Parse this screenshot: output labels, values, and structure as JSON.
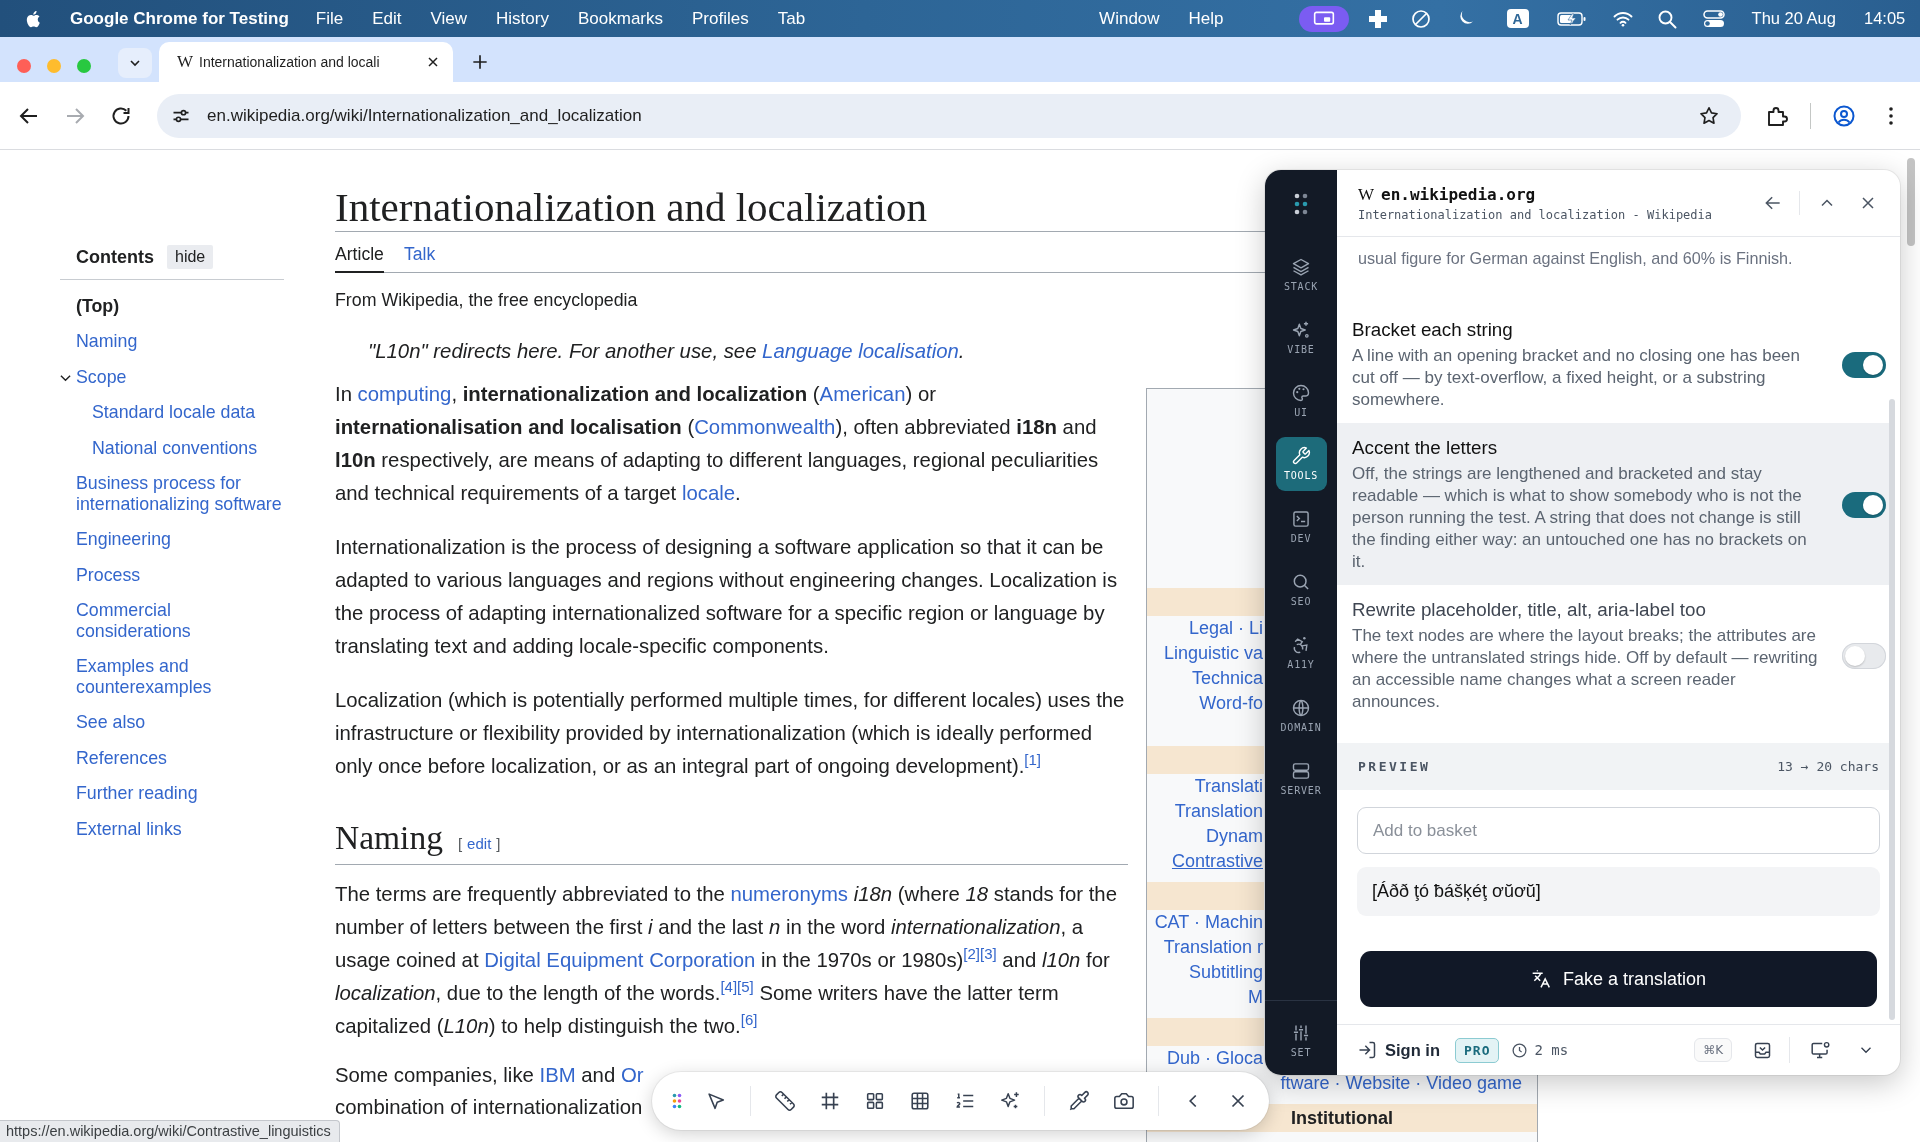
{
  "menu_bar": {
    "app_name": "Google Chrome for Testing",
    "menus": [
      "File",
      "Edit",
      "View",
      "History",
      "Bookmarks",
      "Profiles",
      "Tab"
    ],
    "menus_right": [
      "Window",
      "Help"
    ],
    "input_source": "A",
    "date": "Thu 20 Aug",
    "time": "14:05"
  },
  "browser": {
    "tabs": [
      {
        "favicon": "W",
        "title": "Internationalization and locali",
        "selected": true
      }
    ],
    "back_disabled": false,
    "forward_disabled": true,
    "url": "en.wikipedia.org/wiki/Internationalization_and_localization",
    "status_url": "https://en.wikipedia.org/wiki/Contrastive_linguistics"
  },
  "toc": {
    "title": "Contents",
    "hide_label": "hide",
    "items": [
      {
        "label": "(Top)",
        "selected": true
      },
      {
        "label": "Naming",
        "selected": false
      },
      {
        "label": "Scope",
        "selected": false,
        "expanded": true,
        "children": [
          {
            "label": "Standard locale data",
            "selected": false
          },
          {
            "label": "National conventions",
            "selected": false
          }
        ]
      },
      {
        "label": "Business process for internationalizing software",
        "selected": false
      },
      {
        "label": "Engineering",
        "selected": false
      },
      {
        "label": "Process",
        "selected": false
      },
      {
        "label": "Commercial considerations",
        "selected": false
      },
      {
        "label": "Examples and counterexamples",
        "selected": false
      },
      {
        "label": "See also",
        "selected": false
      },
      {
        "label": "References",
        "selected": false
      },
      {
        "label": "Further reading",
        "selected": false
      },
      {
        "label": "External links",
        "selected": false
      }
    ]
  },
  "article": {
    "title": "Internationalization and localization",
    "tabs": [
      {
        "label": "Article",
        "selected": true
      },
      {
        "label": "Talk",
        "selected": false
      }
    ],
    "tagline": "From Wikipedia, the free encyclopedia",
    "hatnote": [
      {
        "kind": "text",
        "text": "\"L10n\" redirects here. For another use, see "
      },
      {
        "kind": "link",
        "text": "Language localisation"
      },
      {
        "kind": "text",
        "text": "."
      }
    ],
    "blocks": [
      {
        "kind": "paragraph",
        "runs": [
          {
            "kind": "text",
            "text": "In "
          },
          {
            "kind": "link",
            "text": "computing"
          },
          {
            "kind": "text",
            "text": ", **internationalization and localization** ("
          },
          {
            "kind": "link",
            "text": "American"
          },
          {
            "kind": "text",
            "text": ") or **internationalisation and localisation** ("
          },
          {
            "kind": "link",
            "text": "Commonwealth"
          },
          {
            "kind": "text",
            "text": "), often abbreviated **i18n** and **l10n** respectively, are means of adapting to different languages, regional peculiarities and technical requirements of a target "
          },
          {
            "kind": "link",
            "text": "locale"
          },
          {
            "kind": "text",
            "text": "."
          }
        ]
      },
      {
        "kind": "paragraph",
        "runs": [
          {
            "kind": "text",
            "text": "Internationalization is the process of designing a software application so that it can be adapted to various languages and regions without engineering changes. Localization is the process of adapting internationalized software for a specific region or language by translating text and adding locale-specific components."
          }
        ]
      },
      {
        "kind": "paragraph",
        "runs": [
          {
            "kind": "text",
            "text": "Localization (which is potentially performed multiple times, for different locales) uses the infrastructure or flexibility provided by internationalization (which is ideally performed only once before localization, or as an integral part of ongoing development)."
          },
          {
            "kind": "ref",
            "text": "[1]"
          }
        ]
      },
      {
        "kind": "heading",
        "text": "Naming",
        "edit": [
          {
            "kind": "text",
            "text": "["
          },
          {
            "kind": "link",
            "text": "edit"
          },
          {
            "kind": "text",
            "text": "]"
          }
        ]
      },
      {
        "kind": "paragraph",
        "runs": [
          {
            "kind": "text",
            "text": "The terms are frequently abbreviated to the "
          },
          {
            "kind": "link",
            "text": "numeronyms"
          },
          {
            "kind": "text",
            "text": " *i18n* (where *18* stands for the number of letters between the first *i* and the last *n* in the word *internationalization*, a usage coined at "
          },
          {
            "kind": "link",
            "text": "Digital Equipment Corporation"
          },
          {
            "kind": "text",
            "text": " in the 1970s or 1980s)"
          },
          {
            "kind": "ref",
            "text": "[2]"
          },
          {
            "kind": "ref",
            "text": "[3]"
          },
          {
            "kind": "text",
            "text": " and *l10n* for *localization*, due to the length of the words."
          },
          {
            "kind": "ref",
            "text": "[4]"
          },
          {
            "kind": "ref",
            "text": "[5]"
          },
          {
            "kind": "text",
            "text": " Some writers have the latter term capitalized (*L10n*) to help distinguish the two."
          },
          {
            "kind": "ref",
            "text": "[6]"
          }
        ]
      },
      {
        "kind": "cut_paragraph",
        "lines": [
          [
            {
              "kind": "text",
              "text": "Some companies, like "
            },
            {
              "kind": "link",
              "text": "IBM"
            },
            {
              "kind": "text",
              "text": " and "
            },
            {
              "kind": "link",
              "text": "Or"
            }
          ],
          [
            {
              "kind": "text",
              "text": "combination of internationalization"
            }
          ]
        ]
      }
    ]
  },
  "infobox": {
    "sections": [
      {
        "lines": [
          {
            "kind": "left_part",
            "text": "Legal · Li",
            "hovered": false
          },
          {
            "kind": "left_part",
            "text": "Linguistic va",
            "hovered": false
          },
          {
            "kind": "left_part",
            "text": "Technica",
            "hovered": false
          },
          {
            "kind": "left_part",
            "text": "Word-fo",
            "hovered": false
          }
        ]
      },
      {
        "lines": [
          {
            "kind": "left_part",
            "text": "Translati",
            "hovered": false
          },
          {
            "kind": "left_part",
            "text": "Translation",
            "hovered": false
          },
          {
            "kind": "left_part",
            "text": "Dynam",
            "hovered": false
          },
          {
            "kind": "left_part",
            "text": "Contrastive",
            "hovered": true
          }
        ]
      },
      {
        "lines": [
          {
            "kind": "left_part",
            "text": "CAT · Machin",
            "hovered": false
          },
          {
            "kind": "left_part",
            "text": "Translation r",
            "hovered": false
          },
          {
            "kind": "left_part",
            "text": "Subtitling",
            "hovered": false
          },
          {
            "kind": "left_part",
            "text": "M",
            "hovered": false
          }
        ]
      },
      {
        "lines": [
          {
            "kind": "left_part",
            "text": "Dub · Gloca",
            "hovered": false
          },
          {
            "kind": "right_part",
            "text": "ftware · Website · Video game",
            "hovered": false
          }
        ]
      },
      {
        "header": "Institutional"
      }
    ]
  },
  "devtool_panel": {
    "rail": {
      "items": [
        {
          "label": "STACK",
          "selected": false
        },
        {
          "label": "VIBE",
          "selected": false
        },
        {
          "label": "UI",
          "selected": false
        },
        {
          "label": "TOOLS",
          "selected": true
        },
        {
          "label": "DEV",
          "selected": false
        },
        {
          "label": "SEO",
          "selected": false
        },
        {
          "label": "A11Y",
          "selected": false
        },
        {
          "label": "DOMAIN",
          "selected": false
        },
        {
          "label": "SERVER",
          "selected": false
        }
      ],
      "bottom_item": {
        "label": "SET"
      }
    },
    "header": {
      "favicon": "W",
      "site": "en.wikipedia.org",
      "page_title": "Internationalization and localization - Wikipedia"
    },
    "intro_tail": "usual figure for German against English, and 60% is Finnish.",
    "options": [
      {
        "title": "Bracket each string",
        "description": "A line with an opening bracket and no closing one has been cut off — by text-overflow, a fixed height, or a substring somewhere.",
        "on": true,
        "highlighted": false
      },
      {
        "title": "Accent the letters",
        "description": "Off, the strings are lengthened and bracketed and stay readable — which is what to show somebody who is not the person running the test. A string that does not change is still the finding either way: an untouched one has no brackets on it.",
        "on": true,
        "highlighted": true
      },
      {
        "title": "Rewrite placeholder, title, alt, aria-label too",
        "description": "The text nodes are where the layout breaks; the attributes are where the untranslated strings hide. Off by default — rewriting an accessible name changes what a screen reader announces.",
        "on": false,
        "highlighted": false
      }
    ],
    "preview": {
      "label": "PREVIEW",
      "stats": "13 → 20 chars",
      "input": {
        "placeholder": "Add to basket"
      },
      "output": "[Áðð ţó ƀášķéţ ơŭơŭ]"
    },
    "action_button": "Fake a translation",
    "footer": {
      "sign_in": "Sign in",
      "plan_badge": "PRO",
      "timing": "2 ms",
      "shortcut": "⌘K"
    }
  }
}
